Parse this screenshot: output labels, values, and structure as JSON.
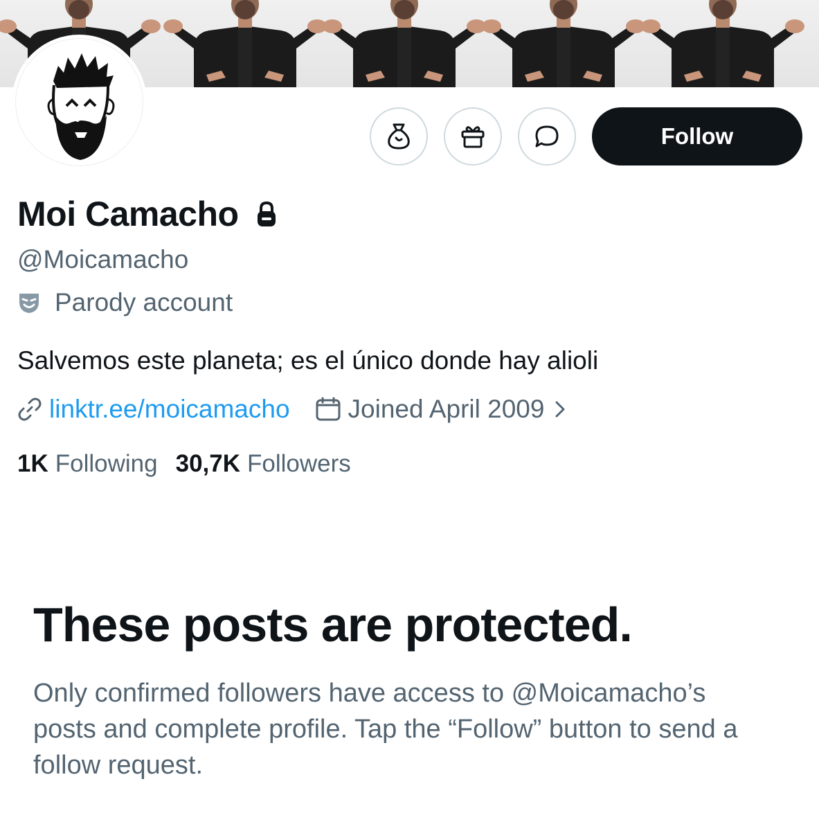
{
  "profile": {
    "name": "Moi Camacho",
    "handle": "@Moicamacho",
    "label": "Parody account",
    "bio": "Salvemos este planeta; es el único donde hay alioli",
    "link": "linktr.ee/moicamacho",
    "joined": "Joined April 2009",
    "following_count": "1K",
    "following_label": "Following",
    "followers_count": "30,7K",
    "followers_label": "Followers",
    "protected": true
  },
  "actions": {
    "follow_label": "Follow",
    "icons": [
      "money-bag-icon",
      "gift-icon",
      "message-icon"
    ]
  },
  "notice": {
    "title": "These posts are protected.",
    "description": "Only confirmed followers have access to @Moicamacho’s posts and complete profile. Tap the “Follow” button to send a follow request."
  },
  "colors": {
    "text_primary": "#0f1419",
    "text_secondary": "#536471",
    "link": "#1d9bf0",
    "button_bg": "#0f1419",
    "border": "#cfd9de"
  }
}
